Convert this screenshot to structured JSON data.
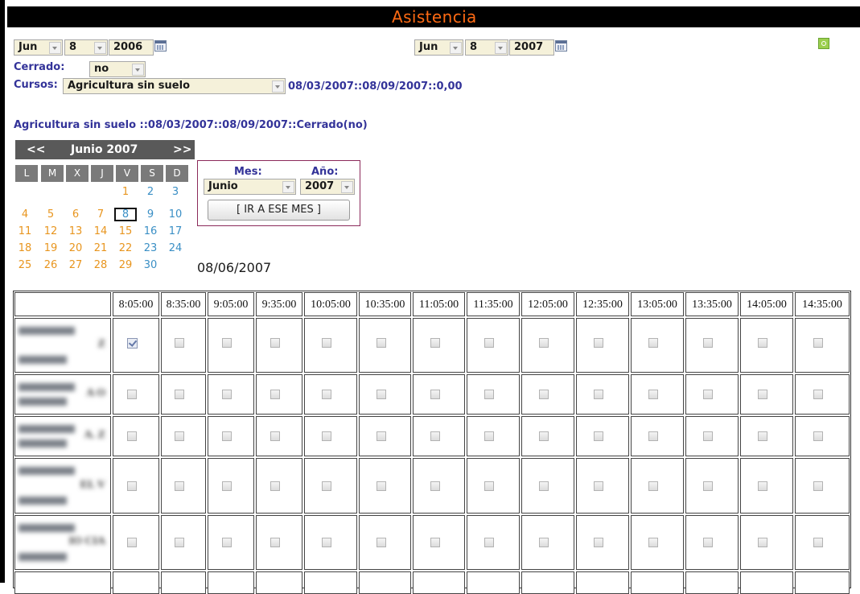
{
  "app": {
    "title": "Asistencia"
  },
  "filters": {
    "from": {
      "month": "Jun",
      "day": "8",
      "year": "2006"
    },
    "to": {
      "month": "Jun",
      "day": "8",
      "year": "2007"
    },
    "cerrado_label": "Cerrado:",
    "cerrado_value": "no",
    "cursos_label": "Cursos:",
    "curso_value": "Agricultura sin suelo",
    "curso_info": "08/03/2007::08/09/2007::0,00"
  },
  "course_summary": "Agricultura sin suelo ::08/03/2007::08/09/2007::Cerrado(no)",
  "calendar": {
    "prev": "<<",
    "next": ">>",
    "month_title": "Junio 2007",
    "weekdays": [
      "L",
      "M",
      "X",
      "J",
      "V",
      "S",
      "D"
    ],
    "weeks": [
      [
        "",
        "",
        "",
        "",
        "1",
        "2",
        "3"
      ],
      [
        "4",
        "5",
        "6",
        "7",
        "8",
        "9",
        "10"
      ],
      [
        "11",
        "12",
        "13",
        "14",
        "15",
        "16",
        "17"
      ],
      [
        "18",
        "19",
        "20",
        "21",
        "22",
        "23",
        "24"
      ],
      [
        "25",
        "26",
        "27",
        "28",
        "29",
        "30",
        ""
      ]
    ],
    "selected_day": "8"
  },
  "month_picker": {
    "mes_label": "Mes:",
    "anio_label": "Año:",
    "mes_value": "Junio",
    "anio_value": "2007",
    "go_button": "[ IR A ESE MES ]"
  },
  "selected_date": "08/06/2007",
  "attendance": {
    "times": [
      "8:05:00",
      "8:35:00",
      "9:05:00",
      "9:35:00",
      "10:05:00",
      "10:35:00",
      "11:05:00",
      "11:35:00",
      "12:05:00",
      "12:35:00",
      "13:05:00",
      "13:35:00",
      "14:05:00",
      "14:35:00"
    ],
    "rows": [
      {
        "name_visible": "Z",
        "checked": [
          true,
          false,
          false,
          false,
          false,
          false,
          false,
          false,
          false,
          false,
          false,
          false,
          false,
          false
        ]
      },
      {
        "name_visible": "A O",
        "checked": [
          false,
          false,
          false,
          false,
          false,
          false,
          false,
          false,
          false,
          false,
          false,
          false,
          false,
          false
        ]
      },
      {
        "name_visible": "A. Z",
        "checked": [
          false,
          false,
          false,
          false,
          false,
          false,
          false,
          false,
          false,
          false,
          false,
          false,
          false,
          false
        ]
      },
      {
        "name_visible": "EL V",
        "checked": [
          false,
          false,
          false,
          false,
          false,
          false,
          false,
          false,
          false,
          false,
          false,
          false,
          false,
          false
        ]
      },
      {
        "name_visible": "IO CIA",
        "checked": [
          false,
          false,
          false,
          false,
          false,
          false,
          false,
          false,
          false,
          false,
          false,
          false,
          false,
          false
        ]
      }
    ]
  },
  "colors": {
    "title": "#ff6a13",
    "label": "#333399",
    "weekend": "#e8951e",
    "weekday": "#3a8fc5"
  }
}
